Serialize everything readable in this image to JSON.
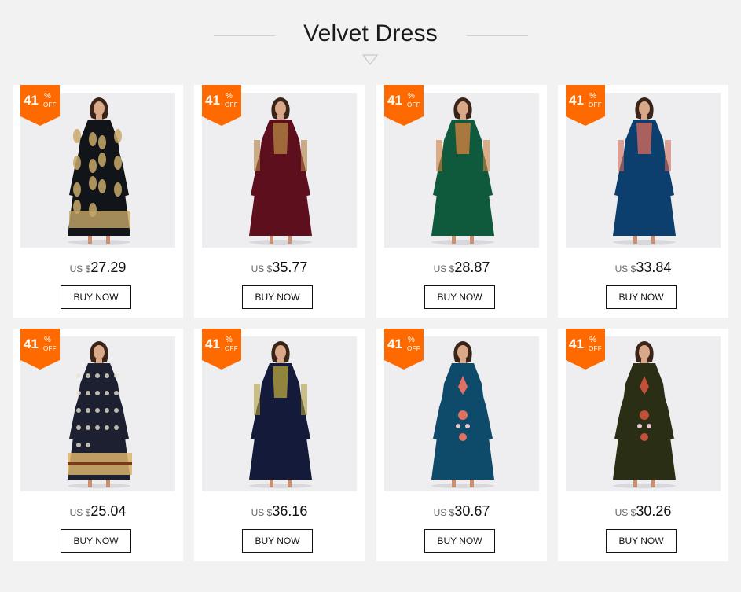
{
  "section": {
    "title": "Velvet Dress"
  },
  "discount": {
    "value": "41",
    "percent": "%",
    "off": "OFF"
  },
  "currency_prefix": "US $",
  "buy_label": "BUY NOW",
  "products": [
    {
      "price": "27.29",
      "dress_color": "#111418",
      "accent_color": "#c8a86a",
      "pattern": "gold-print"
    },
    {
      "price": "35.77",
      "dress_color": "#5e0f1e",
      "accent_color": "#b08040",
      "pattern": "embroidered-yoke"
    },
    {
      "price": "28.87",
      "dress_color": "#0f5a3c",
      "accent_color": "#d08040",
      "pattern": "embroidered-yoke"
    },
    {
      "price": "33.84",
      "dress_color": "#0d3f6e",
      "accent_color": "#d06a5a",
      "pattern": "embroidered-yoke"
    },
    {
      "price": "25.04",
      "dress_color": "#1c2030",
      "accent_color": "#d9b46a",
      "pattern": "printed"
    },
    {
      "price": "36.16",
      "dress_color": "#141a3a",
      "accent_color": "#b0a040",
      "pattern": "embroidered-yoke"
    },
    {
      "price": "30.67",
      "dress_color": "#0e4a6a",
      "accent_color": "#e07060",
      "pattern": "floral-motifs"
    },
    {
      "price": "30.26",
      "dress_color": "#2a2e14",
      "accent_color": "#c0503a",
      "pattern": "floral-motifs"
    }
  ],
  "colors": {
    "background": "#f2f2f2",
    "badge": "#ff6a00",
    "card": "#ffffff"
  }
}
